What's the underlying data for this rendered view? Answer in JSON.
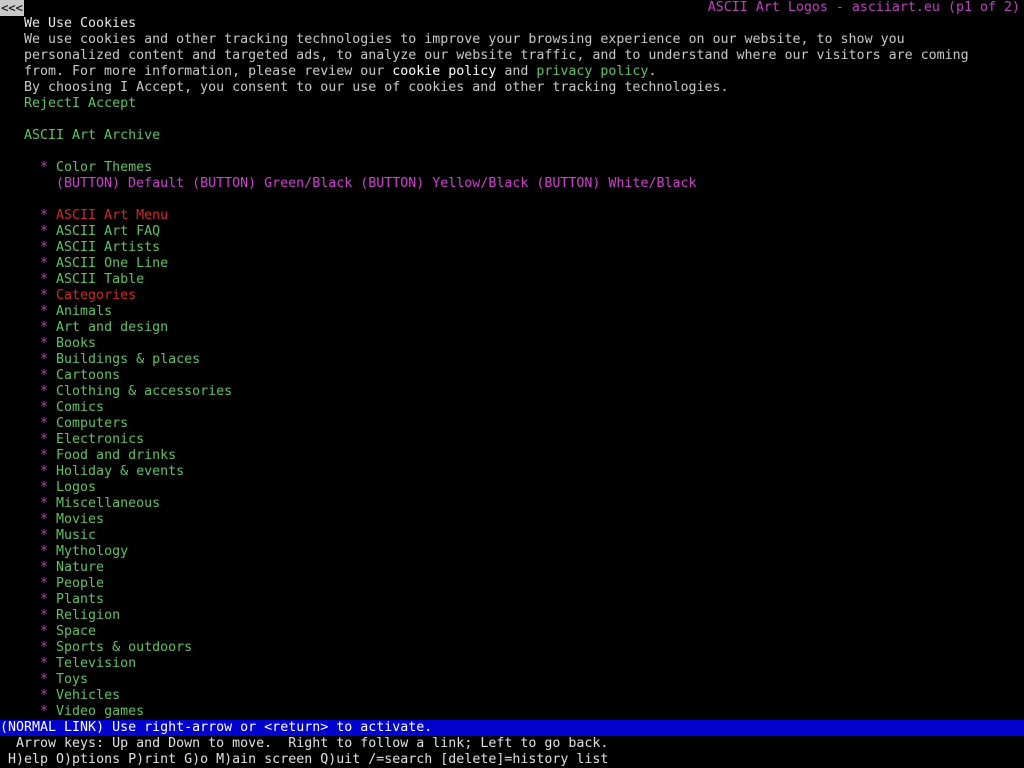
{
  "window": {
    "back_glyph": "<<<",
    "title": "ASCII Art Logos - asciiart.eu (p1 of 2)"
  },
  "cookie": {
    "heading": "We Use Cookies",
    "line1": "We use cookies and other tracking technologies to improve your browsing experience on our website, to show you",
    "line2": "personalized content and targeted ads, to analyze our website traffic, and to understand where our visitors are coming",
    "line3_prefix": "from. For more information, please review our ",
    "cookie_policy_link": "cookie policy",
    "line3_and": " and ",
    "privacy_policy_link": "privacy policy",
    "line3_suffix": ".",
    "line4": "By choosing I Accept, you consent to our use of cookies and other tracking technologies.",
    "reject_link": "Reject",
    "accept_link": "I Accept"
  },
  "archive": {
    "heading": "ASCII Art Archive",
    "bullet": "*",
    "color_themes_label": "Color Themes",
    "theme_buttons": [
      "(BUTTON) Default",
      "(BUTTON) Green/Black",
      "(BUTTON) Yellow/Black",
      "(BUTTON) White/Black"
    ]
  },
  "menu": {
    "items": [
      {
        "label": "ASCII Art Menu",
        "color": "red"
      },
      {
        "label": "ASCII Art FAQ",
        "color": "green"
      },
      {
        "label": "ASCII Artists",
        "color": "green"
      },
      {
        "label": "ASCII One Line",
        "color": "green"
      },
      {
        "label": "ASCII Table",
        "color": "green"
      },
      {
        "label": "Categories",
        "color": "red"
      },
      {
        "label": "Animals",
        "color": "green"
      },
      {
        "label": "Art and design",
        "color": "green"
      },
      {
        "label": "Books",
        "color": "green"
      },
      {
        "label": "Buildings & places",
        "color": "green"
      },
      {
        "label": "Cartoons",
        "color": "green"
      },
      {
        "label": "Clothing & accessories",
        "color": "green"
      },
      {
        "label": "Comics",
        "color": "green"
      },
      {
        "label": "Computers",
        "color": "green"
      },
      {
        "label": "Electronics",
        "color": "green"
      },
      {
        "label": "Food and drinks",
        "color": "green"
      },
      {
        "label": "Holiday & events",
        "color": "green"
      },
      {
        "label": "Logos",
        "color": "green"
      },
      {
        "label": "Miscellaneous",
        "color": "green"
      },
      {
        "label": "Movies",
        "color": "green"
      },
      {
        "label": "Music",
        "color": "green"
      },
      {
        "label": "Mythology",
        "color": "green"
      },
      {
        "label": "Nature",
        "color": "green"
      },
      {
        "label": "People",
        "color": "green"
      },
      {
        "label": "Plants",
        "color": "green"
      },
      {
        "label": "Religion",
        "color": "green"
      },
      {
        "label": "Space",
        "color": "green"
      },
      {
        "label": "Sports & outdoors",
        "color": "green"
      },
      {
        "label": "Television",
        "color": "green"
      },
      {
        "label": "Toys",
        "color": "green"
      },
      {
        "label": "Vehicles",
        "color": "green"
      },
      {
        "label": "Video games",
        "color": "green"
      }
    ]
  },
  "status": {
    "message": "(NORMAL LINK) Use right-arrow or <return> to activate.",
    "help1": "  Arrow keys: Up and Down to move.  Right to follow a link; Left to go back.",
    "help2": " H)elp O)ptions P)rint G)o M)ain screen Q)uit /=search [delete]=history list"
  },
  "colors": {
    "background": "#000000",
    "text": "#c8c8c8",
    "link": "#5fc25f",
    "bullet": "#c040c0",
    "current_link": "#d02828",
    "status_bar": "#0000cc"
  }
}
